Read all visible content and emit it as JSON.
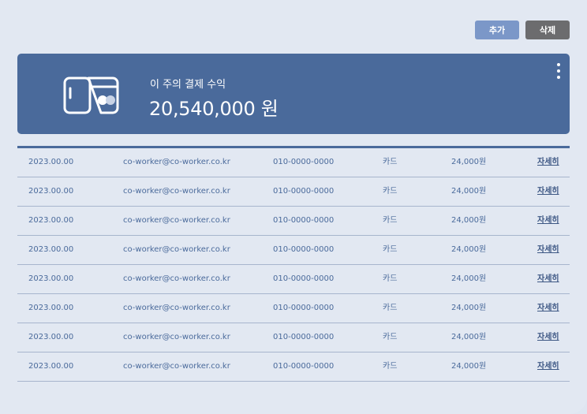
{
  "toolbar": {
    "add_label": "추가",
    "delete_label": "삭제"
  },
  "summary": {
    "label": "이 주의 결제 수익",
    "amount": "20,540,000 원",
    "icon": "payment-card-icon"
  },
  "colors": {
    "accent": "#4a6a9b",
    "add_button": "#7b97c8",
    "delete_button": "#6c6c6e",
    "background": "#e2e8f2"
  },
  "payments": [
    {
      "date": "2023.00.00",
      "email": "co-worker@co-worker.co.kr",
      "phone": "010-0000-0000",
      "method": "카드",
      "amount": "24,000원",
      "detail": "자세히"
    },
    {
      "date": "2023.00.00",
      "email": "co-worker@co-worker.co.kr",
      "phone": "010-0000-0000",
      "method": "카드",
      "amount": "24,000원",
      "detail": "자세히"
    },
    {
      "date": "2023.00.00",
      "email": "co-worker@co-worker.co.kr",
      "phone": "010-0000-0000",
      "method": "카드",
      "amount": "24,000원",
      "detail": "자세히"
    },
    {
      "date": "2023.00.00",
      "email": "co-worker@co-worker.co.kr",
      "phone": "010-0000-0000",
      "method": "카드",
      "amount": "24,000원",
      "detail": "자세히"
    },
    {
      "date": "2023.00.00",
      "email": "co-worker@co-worker.co.kr",
      "phone": "010-0000-0000",
      "method": "카드",
      "amount": "24,000원",
      "detail": "자세히"
    },
    {
      "date": "2023.00.00",
      "email": "co-worker@co-worker.co.kr",
      "phone": "010-0000-0000",
      "method": "카드",
      "amount": "24,000원",
      "detail": "자세히"
    },
    {
      "date": "2023.00.00",
      "email": "co-worker@co-worker.co.kr",
      "phone": "010-0000-0000",
      "method": "카드",
      "amount": "24,000원",
      "detail": "자세히"
    },
    {
      "date": "2023.00.00",
      "email": "co-worker@co-worker.co.kr",
      "phone": "010-0000-0000",
      "method": "카드",
      "amount": "24,000원",
      "detail": "자세히"
    }
  ]
}
